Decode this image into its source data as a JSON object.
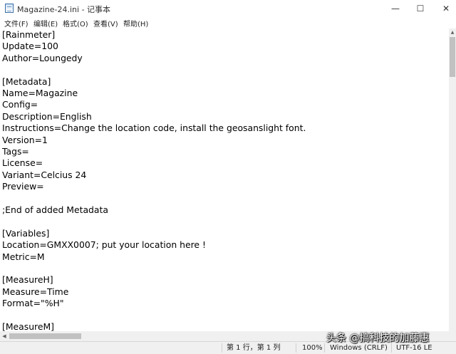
{
  "window": {
    "title": "Magazine-24.ini - 记事本",
    "minimize_glyph": "—",
    "maximize_glyph": "☐",
    "close_glyph": "✕"
  },
  "menu": [
    "文件(F)",
    "编辑(E)",
    "格式(O)",
    "查看(V)",
    "帮助(H)"
  ],
  "editor": {
    "lines": [
      "[Rainmeter]",
      "Update=100",
      "Author=Loungedy",
      "",
      "[Metadata]",
      "Name=Magazine",
      "Config=",
      "Description=English",
      "Instructions=Change the location code, install the geosanslight font.",
      "Version=1",
      "Tags=",
      "License=",
      "Variant=Celcius 24",
      "Preview=",
      "",
      ";End of added Metadata",
      "",
      "[Variables]",
      "Location=GMXX0007; put your location here !",
      "Metric=M",
      "",
      "[MeasureH]",
      "Measure=Time",
      "Format=\"%H\"",
      "",
      "[MeasureM]"
    ]
  },
  "statusbar": {
    "position": "第 1 行，第 1 列",
    "zoom": "100%",
    "line_ending": "Windows (CRLF)",
    "encoding": "UTF-16 LE"
  },
  "watermark": "头条 @搞科技的加藤惠"
}
